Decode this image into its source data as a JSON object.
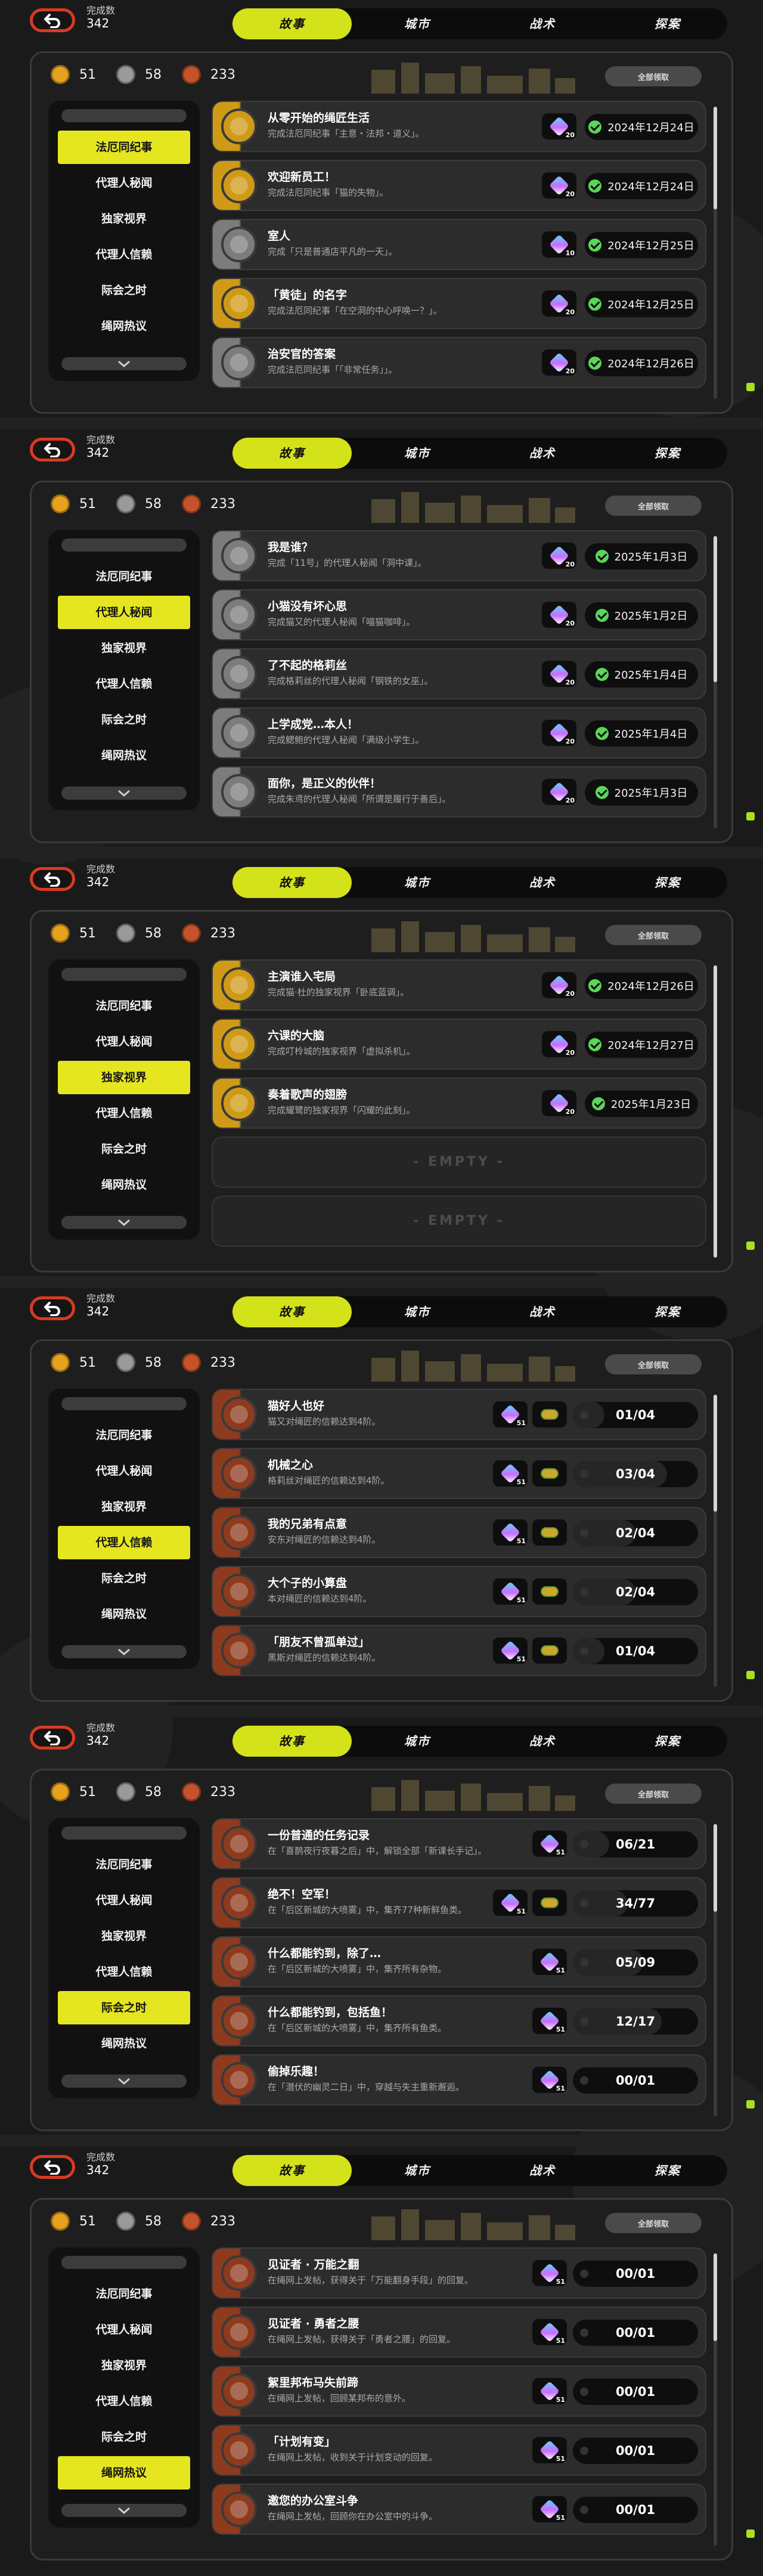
{
  "counter": {
    "label": "完成数",
    "value": "342"
  },
  "tabs": [
    "故事",
    "城市",
    "战术",
    "探案"
  ],
  "currencies": [
    {
      "name": "gold-coin",
      "value": "51",
      "color": "#e6a21d"
    },
    {
      "name": "silver-coin",
      "value": "58",
      "color": "#9a9a9a"
    },
    {
      "name": "bronze-coin",
      "value": "233",
      "color": "#c4522a"
    }
  ],
  "claim_all_label": "全部领取",
  "sidebar_items": [
    "法厄同纪事",
    "代理人秘闻",
    "独家视界",
    "代理人信赖",
    "际会之时",
    "绳网热议"
  ],
  "empty_label": "- EMPTY -",
  "colors": {
    "accent": "#d4e21a",
    "sidebar_active": "#e6e620",
    "back_button": "#d93a22",
    "done_check": "#5bd55b",
    "row_gold": "#cf9a16",
    "row_bronze": "#8e3a1e",
    "row_grey": "#7c7c7c"
  },
  "panels": [
    {
      "active_tab": 0,
      "active_sidebar": 0,
      "rows": [
        {
          "icon": "gold-medal-icon",
          "tier": "gold",
          "title": "从零开始的绳匠生活",
          "desc": "完成法厄同纪事「主意・法邦・道义」。",
          "reward": {
            "type": "gem",
            "count": "20"
          },
          "status": {
            "kind": "done",
            "date": "2024年12月24日"
          }
        },
        {
          "icon": "gold-medal-icon",
          "tier": "gold",
          "title": "欢迎新员工！",
          "desc": "完成法厄同纪事「猫的失物」。",
          "reward": {
            "type": "gem",
            "count": "20"
          },
          "status": {
            "kind": "done",
            "date": "2024年12月24日"
          }
        },
        {
          "icon": "silver-medal-icon",
          "tier": "grey",
          "title": "室人",
          "desc": "完成「只是普通店平凡的一天」。",
          "reward": {
            "type": "gem",
            "count": "10"
          },
          "status": {
            "kind": "done",
            "date": "2024年12月25日"
          }
        },
        {
          "icon": "gold-medal-icon",
          "tier": "gold",
          "title": "「黄徒」的名字",
          "desc": "完成法厄同纪事「在空洞的中心呼唤一？」。",
          "reward": {
            "type": "gem",
            "count": "20"
          },
          "status": {
            "kind": "done",
            "date": "2024年12月25日"
          }
        },
        {
          "icon": "silver-medal-icon",
          "tier": "grey",
          "title": "治安官的答案",
          "desc": "完成法厄同纪事「「非常任务」」。",
          "reward": {
            "type": "gem",
            "count": "20"
          },
          "status": {
            "kind": "done",
            "date": "2024年12月26日"
          }
        }
      ],
      "empty_rows": 0,
      "scroll_thumb": 0.35
    },
    {
      "active_tab": 0,
      "active_sidebar": 1,
      "rows": [
        {
          "icon": "silver-medal-icon",
          "tier": "grey",
          "title": "我是谁？",
          "desc": "完成「11号」的代理人秘闻「洞中课」。",
          "reward": {
            "type": "gem",
            "count": "20"
          },
          "status": {
            "kind": "done",
            "date": "2025年1月3日"
          }
        },
        {
          "icon": "silver-medal-icon",
          "tier": "grey",
          "title": "小猫没有坏心思",
          "desc": "完成猫又的代理人秘闻「喵猫咖啡」。",
          "reward": {
            "type": "gem",
            "count": "20"
          },
          "status": {
            "kind": "done",
            "date": "2025年1月2日"
          }
        },
        {
          "icon": "silver-medal-icon",
          "tier": "grey",
          "title": "了不起的格莉丝",
          "desc": "完成格莉丝的代理人秘闻「钢铁的女巫」。",
          "reward": {
            "type": "gem",
            "count": "20"
          },
          "status": {
            "kind": "done",
            "date": "2025年1月4日"
          }
        },
        {
          "icon": "silver-medal-icon",
          "tier": "grey",
          "title": "上学成党…本人！",
          "desc": "完成鳃鲍的代理人秘闻「满级小学生」。",
          "reward": {
            "type": "gem",
            "count": "20"
          },
          "status": {
            "kind": "done",
            "date": "2025年1月4日"
          }
        },
        {
          "icon": "silver-medal-icon",
          "tier": "grey",
          "title": "面你，是正义的伙伴！",
          "desc": "完成朱鸢的代理人秘闻「所谓是履行于善后」。",
          "reward": {
            "type": "gem",
            "count": "20"
          },
          "status": {
            "kind": "done",
            "date": "2025年1月3日"
          }
        }
      ],
      "empty_rows": 0,
      "scroll_thumb": 0.5
    },
    {
      "active_tab": 0,
      "active_sidebar": 2,
      "rows": [
        {
          "icon": "gold-medal-icon",
          "tier": "gold",
          "title": "主演谁入宅局",
          "desc": "完成猫·杜的独家视界「卧底蓝调」。",
          "reward": {
            "type": "gem",
            "count": "20"
          },
          "status": {
            "kind": "done",
            "date": "2024年12月26日"
          }
        },
        {
          "icon": "gold-medal-icon",
          "tier": "gold",
          "title": "六课的大脑",
          "desc": "完成叮柃城的独家视界「虚拟杀机」。",
          "reward": {
            "type": "gem",
            "count": "20"
          },
          "status": {
            "kind": "done",
            "date": "2024年12月27日"
          }
        },
        {
          "icon": "gold-medal-icon",
          "tier": "gold",
          "title": "奏着歌声的翅膀",
          "desc": "完成耀鹭的独家视界「闪耀的此刻」。",
          "reward": {
            "type": "gem",
            "count": "20"
          },
          "status": {
            "kind": "done",
            "date": "2025年1月23日"
          }
        }
      ],
      "empty_rows": 2,
      "scroll_thumb": 1
    },
    {
      "active_tab": 0,
      "active_sidebar": 3,
      "rows": [
        {
          "icon": "bronze-medal-icon",
          "tier": "bronze",
          "title": "猫好人也好",
          "desc": "猫又对绳匠的信赖达到4阶。",
          "reward": {
            "type": "pair",
            "count": "51"
          },
          "status": {
            "kind": "progress",
            "text": "01/04",
            "fraction": 0.25
          }
        },
        {
          "icon": "bronze-medal-icon",
          "tier": "bronze",
          "title": "机械之心",
          "desc": "格莉丝对绳匠的信赖达到4阶。",
          "reward": {
            "type": "pair",
            "count": "51"
          },
          "status": {
            "kind": "progress",
            "text": "03/04",
            "fraction": 0.75
          }
        },
        {
          "icon": "bronze-medal-icon",
          "tier": "bronze",
          "title": "我的兄弟有点意",
          "desc": "安东对绳匠的信赖达到4阶。",
          "reward": {
            "type": "pair",
            "count": "51"
          },
          "status": {
            "kind": "progress",
            "text": "02/04",
            "fraction": 0.5
          }
        },
        {
          "icon": "bronze-medal-icon",
          "tier": "bronze",
          "title": "大个子的小算盘",
          "desc": "本对绳匠的信赖达到4阶。",
          "reward": {
            "type": "pair",
            "count": "51"
          },
          "status": {
            "kind": "progress",
            "text": "02/04",
            "fraction": 0.5
          }
        },
        {
          "icon": "bronze-medal-icon",
          "tier": "bronze",
          "title": "「朋友不曾孤单过」",
          "desc": "黑斯对绳匠的信赖达到4阶。",
          "reward": {
            "type": "pair",
            "count": "51"
          },
          "status": {
            "kind": "progress",
            "text": "01/04",
            "fraction": 0.25
          }
        }
      ],
      "empty_rows": 0,
      "scroll_thumb": 0.4
    },
    {
      "active_tab": 0,
      "active_sidebar": 4,
      "rows": [
        {
          "icon": "bronze-medal-icon",
          "tier": "bronze",
          "title": "一份普通的任务记录",
          "desc": "在「喜鹊夜行夜暮之后」中，解锁全部「新课长手记」。",
          "reward": {
            "type": "gem",
            "count": "51"
          },
          "status": {
            "kind": "progress",
            "text": "06/21",
            "fraction": 0.29
          }
        },
        {
          "icon": "bronze-medal-icon",
          "tier": "bronze",
          "title": "绝不！空军！",
          "desc": "在「后区新城的大喷雾」中，集齐77种新鲜鱼类。",
          "reward": {
            "type": "pair",
            "count": "51"
          },
          "status": {
            "kind": "progress",
            "text": "34/77",
            "fraction": 0.44
          }
        },
        {
          "icon": "bronze-medal-icon",
          "tier": "bronze",
          "title": "什么都能钓到，除了…",
          "desc": "在「后区新城的大喷雾」中，集齐所有杂物。",
          "reward": {
            "type": "gem",
            "count": "51"
          },
          "status": {
            "kind": "progress",
            "text": "05/09",
            "fraction": 0.56
          }
        },
        {
          "icon": "bronze-medal-icon",
          "tier": "bronze",
          "title": "什么都能钓到，包括鱼！",
          "desc": "在「后区新城的大喷雾」中，集齐所有鱼类。",
          "reward": {
            "type": "gem",
            "count": "51"
          },
          "status": {
            "kind": "progress",
            "text": "12/17",
            "fraction": 0.71
          }
        },
        {
          "icon": "bronze-medal-icon",
          "tier": "bronze",
          "title": "偷掉乐趣！",
          "desc": "在「潜伏的幽灵二日」中，穿越与失主重新邂逅。",
          "reward": {
            "type": "gem",
            "count": "51"
          },
          "status": {
            "kind": "progress",
            "text": "00/01",
            "fraction": 0
          }
        }
      ],
      "empty_rows": 0,
      "scroll_thumb": 0.3
    },
    {
      "active_tab": 0,
      "active_sidebar": 5,
      "rows": [
        {
          "icon": "bronze-medal-icon",
          "tier": "bronze",
          "title": "见证者 · 万能之翻",
          "desc": "在绳网上发帖，获得关于「万能翻身手段」的回复。",
          "reward": {
            "type": "gem",
            "count": "51"
          },
          "status": {
            "kind": "progress",
            "text": "00/01",
            "fraction": 0
          }
        },
        {
          "icon": "bronze-medal-icon",
          "tier": "bronze",
          "title": "见证者 · 勇者之腰",
          "desc": "在绳网上发帖，获得关于「勇者之腰」的回复。",
          "reward": {
            "type": "gem",
            "count": "51"
          },
          "status": {
            "kind": "progress",
            "text": "00/01",
            "fraction": 0
          }
        },
        {
          "icon": "bronze-medal-icon",
          "tier": "bronze",
          "title": "絮里邦布马失前蹄",
          "desc": "在绳网上发帖，回顾某邦布的意外。",
          "reward": {
            "type": "gem",
            "count": "51"
          },
          "status": {
            "kind": "progress",
            "text": "00/01",
            "fraction": 0
          }
        },
        {
          "icon": "bronze-medal-icon",
          "tier": "bronze",
          "title": "「计划有变」",
          "desc": "在绳网上发帖，收到关于计划变动的回复。",
          "reward": {
            "type": "gem",
            "count": "51"
          },
          "status": {
            "kind": "progress",
            "text": "00/01",
            "fraction": 0
          }
        },
        {
          "icon": "bronze-medal-icon",
          "tier": "bronze",
          "title": "邀您的办公室斗争",
          "desc": "在绳网上发帖，回顾你在办公室中的斗争。",
          "reward": {
            "type": "gem",
            "count": "51"
          },
          "status": {
            "kind": "progress",
            "text": "00/01",
            "fraction": 0
          }
        }
      ],
      "empty_rows": 0,
      "scroll_thumb": 0.3
    }
  ]
}
